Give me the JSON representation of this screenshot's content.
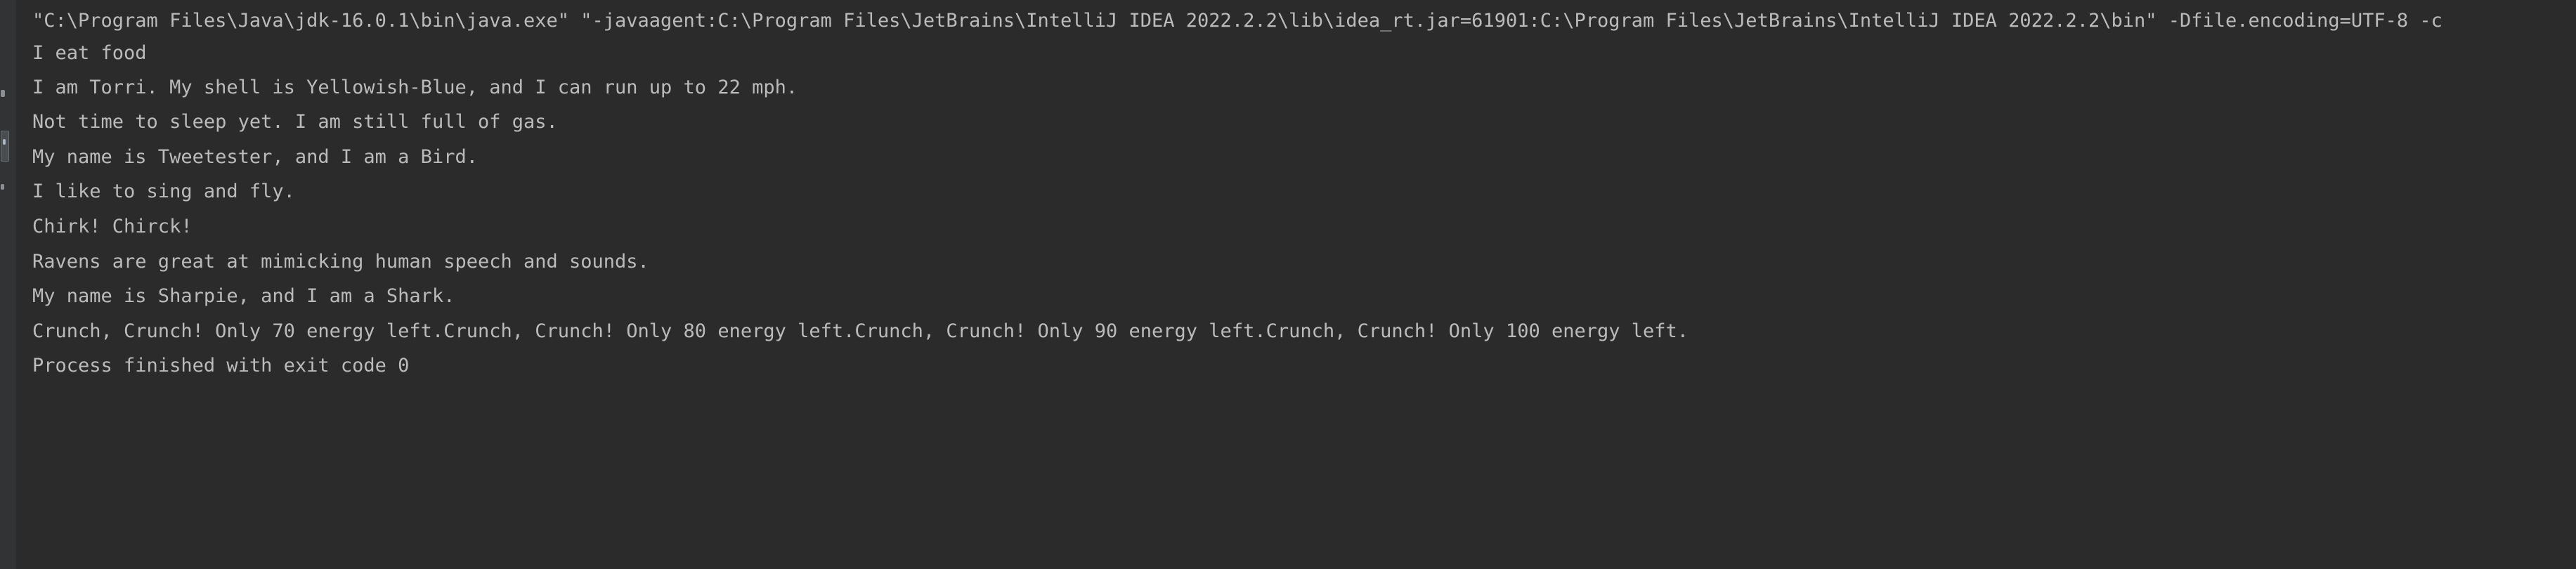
{
  "console": {
    "command_line": "\"C:\\Program Files\\Java\\jdk-16.0.1\\bin\\java.exe\" \"-javaagent:C:\\Program Files\\JetBrains\\IntelliJ IDEA 2022.2.2\\lib\\idea_rt.jar=61901:C:\\Program Files\\JetBrains\\IntelliJ IDEA 2022.2.2\\bin\" -Dfile.encoding=UTF-8 -c",
    "output_lines": [
      "I eat food",
      "I am Torri. My shell is Yellowish-Blue, and I can run up to 22 mph.",
      "Not time to sleep yet. I am still full of gas.",
      "My name is Tweetester, and I am a Bird.",
      "I like to sing and fly.",
      "Chirk! Chirck!",
      "Ravens are great at mimicking human speech and sounds.",
      "My name is Sharpie, and I am a Shark.",
      "Crunch, Crunch! Only 70 energy left.Crunch, Crunch! Only 80 energy left.Crunch, Crunch! Only 90 energy left.Crunch, Crunch! Only 100 energy left."
    ],
    "exit_message": "Process finished with exit code 0"
  },
  "colors": {
    "background": "#2b2b2c",
    "text": "#bbbbbb",
    "gutter": "#313335"
  }
}
